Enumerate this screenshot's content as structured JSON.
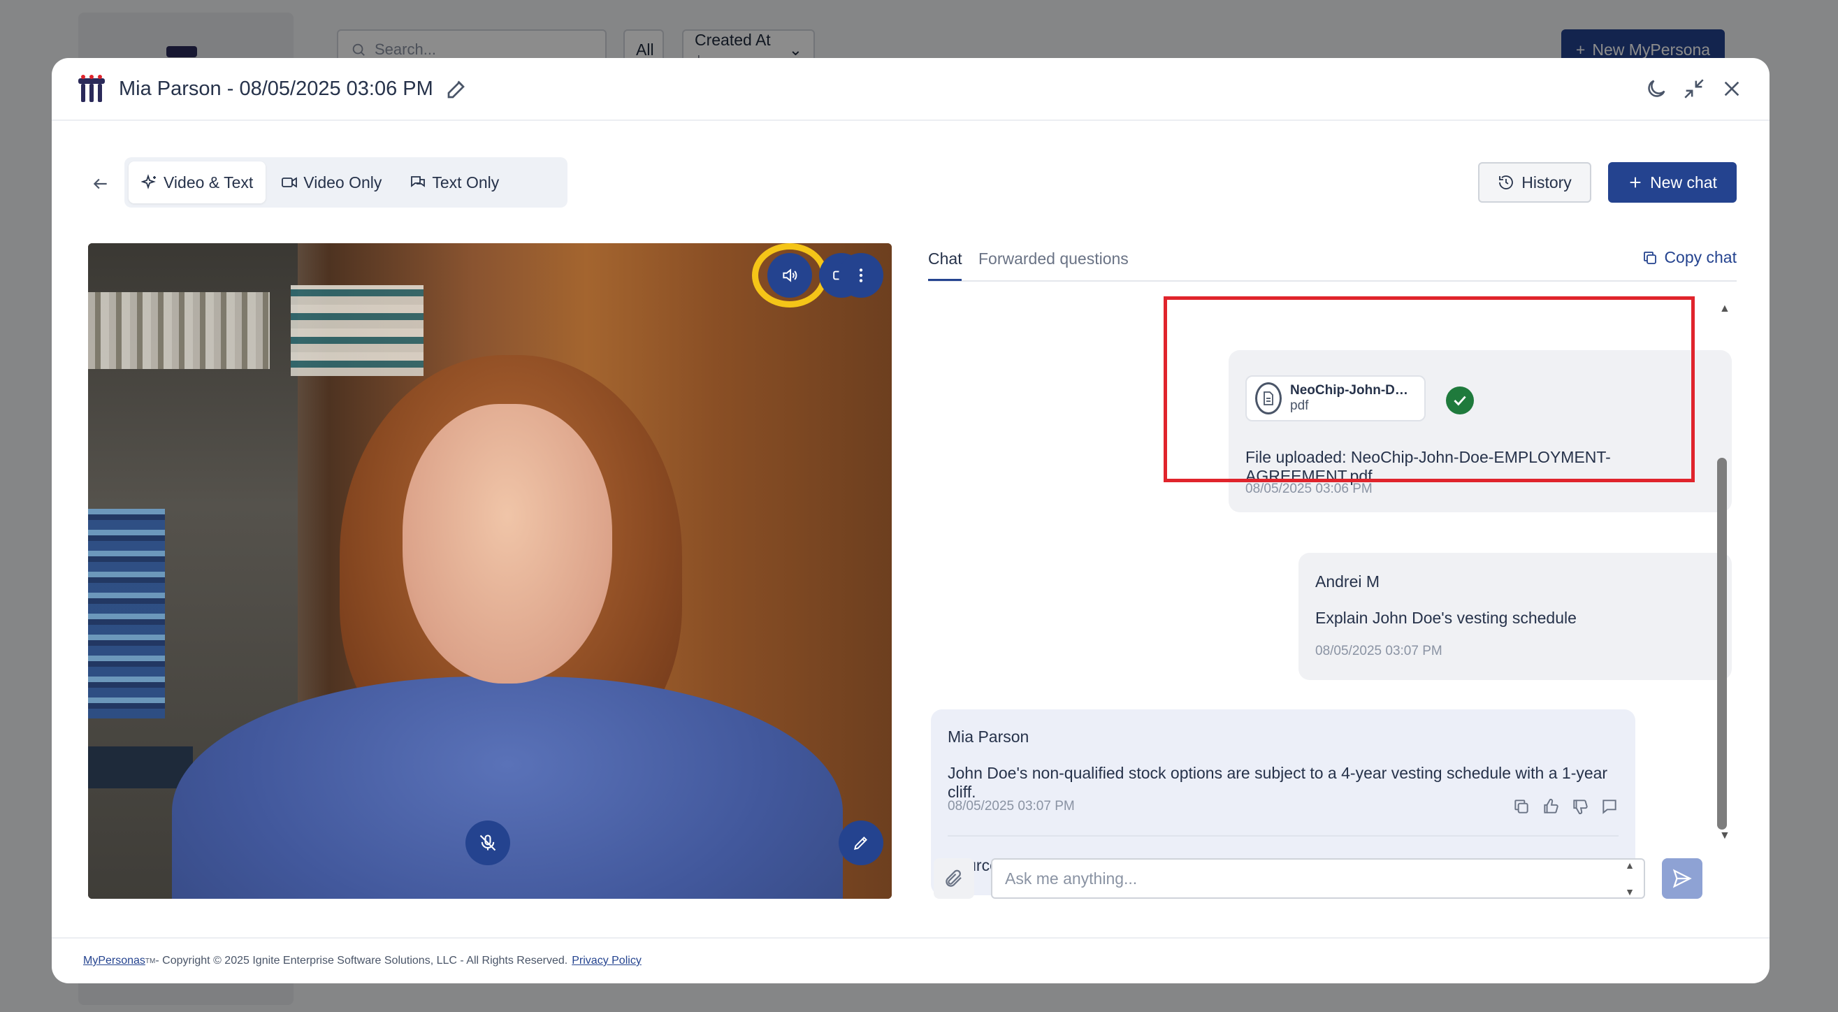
{
  "background": {
    "search_placeholder": "Search...",
    "filter_all": "All",
    "sort_label": "Created At ↓",
    "new_persona_label": "New MyPersona"
  },
  "modal": {
    "title": "Mia Parson - 08/05/2025 03:06 PM",
    "header_icons": [
      "moon-icon",
      "minimize-icon",
      "close-icon"
    ]
  },
  "toolbar": {
    "modes": [
      {
        "label": "Video & Text",
        "icon": "sparkles-icon",
        "active": true
      },
      {
        "label": "Video Only",
        "icon": "video-icon",
        "active": false
      },
      {
        "label": "Text Only",
        "icon": "chat-bubbles-icon",
        "active": false
      }
    ],
    "history_label": "History",
    "new_chat_label": "New chat"
  },
  "video": {
    "controls": [
      "speaker-icon",
      "camera-icon",
      "more-vertical-icon",
      "mic-muted-icon",
      "pen-icon"
    ]
  },
  "chat": {
    "tabs": [
      "Chat",
      "Forwarded questions"
    ],
    "active_tab": "Chat",
    "copy_chat_label": "Copy chat",
    "messages": [
      {
        "type": "file",
        "file_name": "NeoChip-John-Doe...",
        "file_ext": "pdf",
        "text": "File uploaded: NeoChip-John-Doe-EMPLOYMENT-AGREEMENT.pdf",
        "time": "08/05/2025 03:06 PM"
      },
      {
        "type": "user",
        "name": "Andrei M",
        "text": "Explain John Doe's vesting schedule",
        "time": "08/05/2025 03:07 PM"
      },
      {
        "type": "assistant",
        "name": "Mia Parson",
        "text": "John Doe's non-qualified stock options are subject to a 4-year vesting schedule with a 1-year cliff.",
        "time": "08/05/2025 03:07 PM",
        "sources_label": "Sources"
      }
    ],
    "composer_placeholder": "Ask me anything..."
  },
  "footer": {
    "brand": "MyPersonas",
    "trademark": "TM",
    "copyright": " - Copyright © 2025 Ignite Enterprise Software Solutions, LLC - All Rights Reserved.",
    "privacy_label": "Privacy Policy"
  },
  "colors": {
    "primary": "#24438f",
    "highlight_box": "#e0242c",
    "speaker_ring": "#f5c518",
    "success": "#1f7a3c"
  }
}
